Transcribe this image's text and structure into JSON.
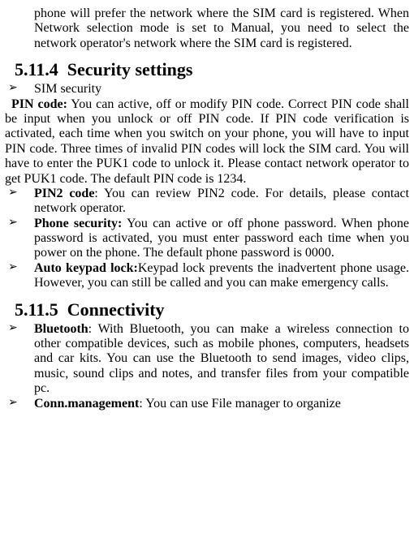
{
  "intro": "phone will prefer the network where the SIM card is registered. When Network selection mode is set to Manual, you need to select the network operator's network where the SIM card is registered.",
  "section1": {
    "number": "5.11.4",
    "title": "Security settings",
    "item1": "SIM security",
    "pin_bold": "PIN code:",
    "pin_text": " You can active, off or modify PIN code. Correct PIN code shall be input when you unlock or off PIN code. If PIN code verification is activated, each time when you switch on your phone, you will have to input PIN code. Three times of invalid PIN codes will lock the SIM card. You will have to enter the PUK1 code to unlock it. Please contact network operator to get PUK1 code. The default PIN code is 1234.",
    "pin2_bold": "PIN2 code",
    "pin2_text": ": You can review PIN2 code. For details, please contact network operator.",
    "phone_bold": "Phone security:",
    "phone_text": " You can active or off phone password. When phone password is activated, you must enter password each time when you power on the phone. The default phone password is 0000.",
    "auto_bold": "Auto keypad lock:",
    "auto_text": "Keypad lock prevents the inadvertent phone usage. However, you can still be called and you can make emergency calls."
  },
  "section2": {
    "number": "5.11.5",
    "title": "Connectivity",
    "bt_bold": "Bluetooth",
    "bt_text": ": With Bluetooth, you can make a wireless connection to other compatible devices, such as mobile phones, computers, headsets and car kits. You can use the Bluetooth to send images, video clips, music, sound clips and notes, and transfer files from your compatible pc.",
    "conn_bold": "Conn.management",
    "conn_text": ": You can use File manager to organize"
  }
}
